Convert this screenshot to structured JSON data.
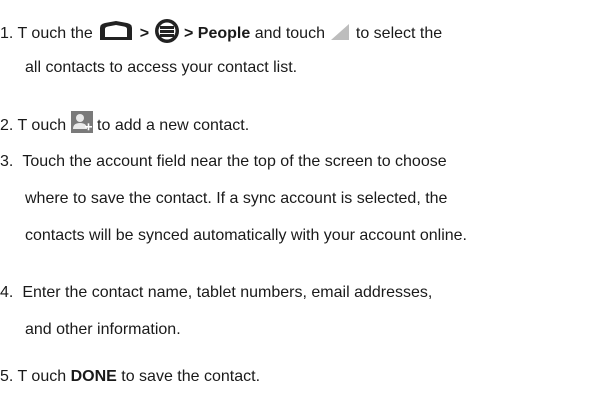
{
  "steps": [
    {
      "number": "1.",
      "line1": {
        "t1": "T ouch the",
        "sep1": ">",
        "sep2": ">",
        "people": "People",
        "t2": "and touch",
        "t3": "to select the"
      },
      "line2": "all contacts to access your contact list."
    },
    {
      "number": "2.",
      "t1": "T ouch",
      "t2": "to add a new contact."
    },
    {
      "number": "3.",
      "lines": [
        "Touch the account field near the top of the screen to choose",
        "where to save the contact. If a sync account is selected, the",
        "contacts will be synced automatically with your account online."
      ]
    },
    {
      "number": "4.",
      "lines": [
        "Enter the contact name, tablet numbers, email addresses,",
        "and other information."
      ]
    },
    {
      "number": "5.",
      "t1": "T ouch",
      "done": "DONE",
      "t2": "to save the contact."
    }
  ],
  "icons": {
    "home": "home-icon",
    "apps": "all-apps-icon",
    "menu_corner": "triangle-menu-icon",
    "add_contact": "add-contact-icon"
  }
}
